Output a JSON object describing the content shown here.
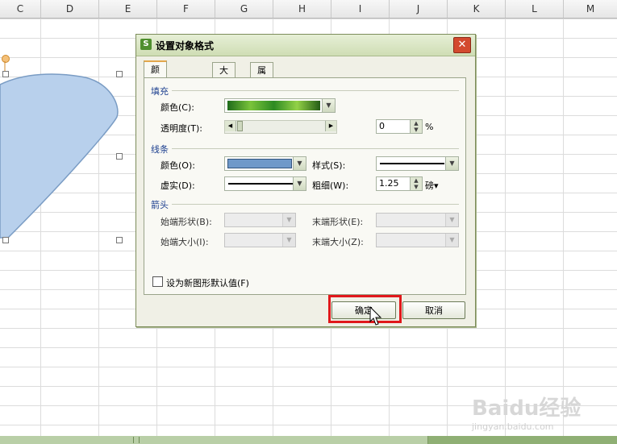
{
  "spreadsheet": {
    "columns": [
      "C",
      "D",
      "E",
      "F",
      "G",
      "H",
      "I",
      "J",
      "K",
      "L",
      "M"
    ]
  },
  "dialog": {
    "title": "设置对象格式",
    "tabs": [
      "颜色与线条",
      "大小",
      "属性"
    ],
    "fill": {
      "section": "填充",
      "color_label": "颜色(C):",
      "transparency_label": "透明度(T):",
      "transparency_value": "0",
      "percent": "%"
    },
    "line": {
      "section": "线条",
      "color_label": "颜色(O):",
      "style_label": "样式(S):",
      "dash_label": "虚实(D):",
      "weight_label": "粗细(W):",
      "weight_value": "1.25",
      "weight_unit": "磅▾",
      "line_color": "#6f99c9"
    },
    "arrows": {
      "section": "箭头",
      "begin_style_label": "始端形状(B):",
      "end_style_label": "末端形状(E):",
      "begin_size_label": "始端大小(I):",
      "end_size_label": "末端大小(Z):"
    },
    "default_checkbox_label": "设为新图形默认值(F)",
    "ok_label": "确定",
    "cancel_label": "取消"
  },
  "watermark": {
    "brand": "Baidu经验",
    "url": "jingyan.baidu.com"
  }
}
